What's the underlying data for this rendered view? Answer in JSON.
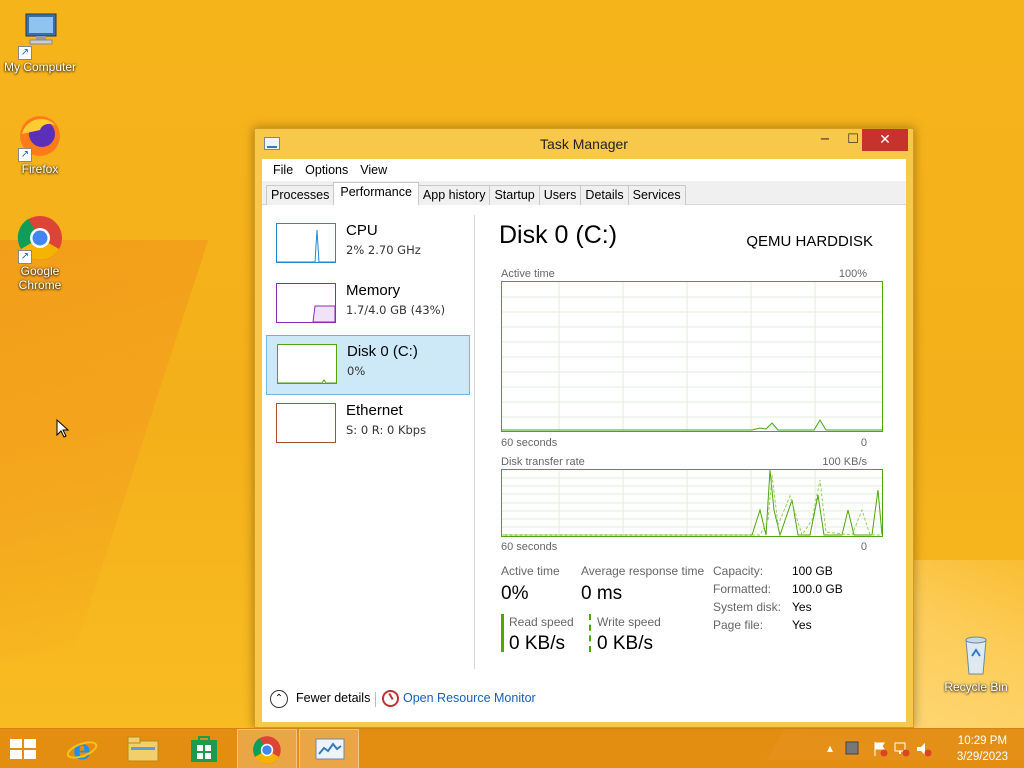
{
  "desktop": {
    "icons": [
      {
        "label": "My Computer"
      },
      {
        "label": "Firefox"
      },
      {
        "label": "Google Chrome"
      },
      {
        "label": "Recycle Bin"
      }
    ]
  },
  "window": {
    "title": "Task Manager",
    "controls": {
      "minimize": "−",
      "maximize": "☐",
      "close": "✕"
    },
    "menu": [
      "File",
      "Options",
      "View"
    ],
    "tabs": [
      "Processes",
      "Performance",
      "App history",
      "Startup",
      "Users",
      "Details",
      "Services"
    ],
    "active_tab": "Performance"
  },
  "sidebar": {
    "items": [
      {
        "name": "CPU",
        "sub": "2% 2.70 GHz",
        "color": "#1e8ad3"
      },
      {
        "name": "Memory",
        "sub": "1.7/4.0 GB (43%)",
        "color": "#8b2bb3"
      },
      {
        "name": "Disk 0 (C:)",
        "sub": "0%",
        "color": "#4da60c"
      },
      {
        "name": "Ethernet",
        "sub": "S: 0 R: 0 Kbps",
        "color": "#a7512a"
      }
    ],
    "selected": 2
  },
  "disk": {
    "title": "Disk 0 (C:)",
    "model": "QEMU HARDDISK",
    "active_time_label": "Active time",
    "active_time_max": "100%",
    "seconds_label": "60 seconds",
    "zero": "0",
    "transfer_label": "Disk transfer rate",
    "transfer_max": "100 KB/s",
    "stats": {
      "active_time": {
        "label": "Active time",
        "value": "0%"
      },
      "avg_response": {
        "label": "Average response time",
        "value": "0 ms"
      },
      "read_speed": {
        "label": "Read speed",
        "value": "0 KB/s"
      },
      "write_speed": {
        "label": "Write speed",
        "value": "0 KB/s"
      }
    },
    "details": [
      {
        "key": "Capacity:",
        "value": "100 GB"
      },
      {
        "key": "Formatted:",
        "value": "100.0 GB"
      },
      {
        "key": "System disk:",
        "value": "Yes"
      },
      {
        "key": "Page file:",
        "value": "Yes"
      }
    ],
    "accent": "#4da60c"
  },
  "footer": {
    "fewer_details": "Fewer details",
    "open_resmon": "Open Resource Monitor"
  },
  "taskbar": {
    "clock_time": "10:29 PM",
    "clock_date": "3/29/2023",
    "pinned": [
      "start-icon",
      "internet-explorer-icon",
      "file-explorer-icon",
      "store-icon",
      "chrome-icon",
      "task-manager-icon"
    ]
  }
}
